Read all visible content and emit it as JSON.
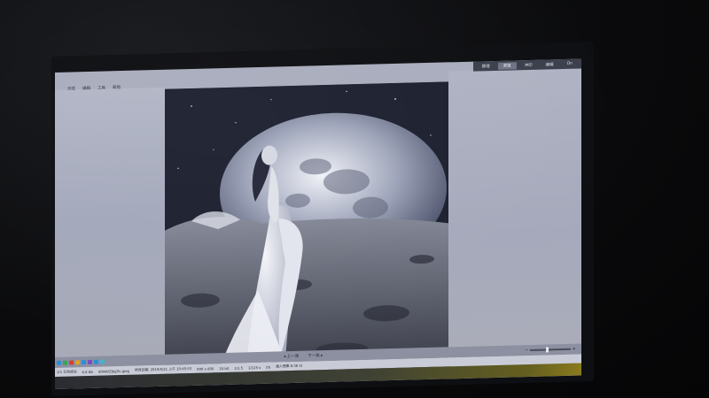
{
  "menubar": {
    "items": [
      {
        "label": "浏览"
      },
      {
        "label": "编辑"
      },
      {
        "label": "工具"
      },
      {
        "label": "帮助"
      }
    ]
  },
  "mode_tabs": [
    {
      "label": "管理",
      "active": false
    },
    {
      "label": "浏览",
      "active": true
    },
    {
      "label": "冲印",
      "active": false
    },
    {
      "label": "编辑",
      "active": false
    },
    {
      "label": "On",
      "active": false
    }
  ],
  "navigation": {
    "previous_label": "◂ 上一张",
    "next_label": "下一张 ▸"
  },
  "zoom": {
    "level_fraction": 0.42
  },
  "status_bar": {
    "items": [
      "1/1 已完成加",
      "6.6 KB",
      "SONWZBeJZn.jpeg",
      "修改日期: 2019/5/21 上午 10:45:53",
      "800 x 800",
      "24 bit",
      "1/1.5",
      "1/125 s",
      "f/5",
      "插入图像 6:36 分"
    ]
  },
  "tool_colors": [
    "#2b8fd8",
    "#3aa35a",
    "#d4422f",
    "#e0a421",
    "#2b8fd8",
    "#7d4cc2",
    "#2b8fd8",
    "#48b0c9"
  ]
}
